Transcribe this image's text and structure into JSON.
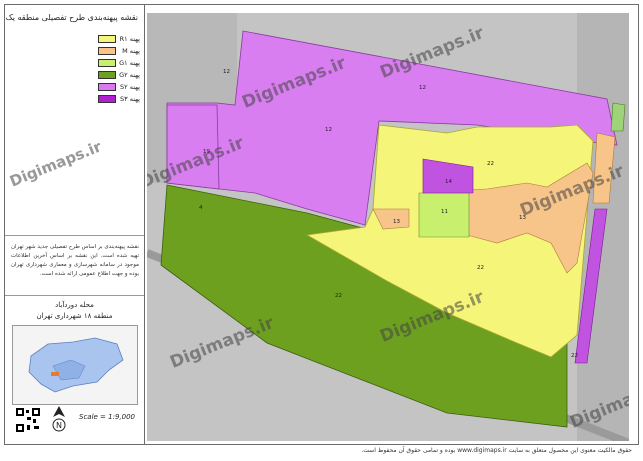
{
  "title": "نقشه پیهنه‌بندی طرح تفصیلی منطقه یک",
  "legend": [
    {
      "label": "پهنه R۱",
      "color": "#f5f57a"
    },
    {
      "label": "پهنه M",
      "color": "#f7c58a"
    },
    {
      "label": "پهنه G۱",
      "color": "#c8f06e"
    },
    {
      "label": "پهنه G۲",
      "color": "#6ea020"
    },
    {
      "label": "پهنه S۲",
      "color": "#d97af0"
    },
    {
      "label": "پهنه S۳",
      "color": "#b020d0"
    }
  ],
  "note": "نقشه پیهنه‌بندی بر اساس طرح تفصیلی جدید شهر تهران تهیه شده است. این نقشه بر اساس آخرین اطلاعات موجود در سامانه شهرسازی و معماری شهرداری تهران بوده و جهت اطلاع عمومی ارائه شده است.",
  "area_name": "محله دوردآباد",
  "district": "منطقه ۱۸ شهرداری تهران",
  "scale": "Scale = 1:9,000",
  "watermark": "Digimaps.ir",
  "footer": "حقوق مالکیت معنوی این محصول متعلق به سایت www.digimaps.ir بوده و تمامی حقوق آن محفوظ است.",
  "zone_labels": [
    "12",
    "12",
    "19",
    "22",
    "14",
    "11",
    "13",
    "13",
    "22",
    "4",
    "22",
    "23",
    "19",
    "22",
    "0",
    "1",
    "12"
  ]
}
